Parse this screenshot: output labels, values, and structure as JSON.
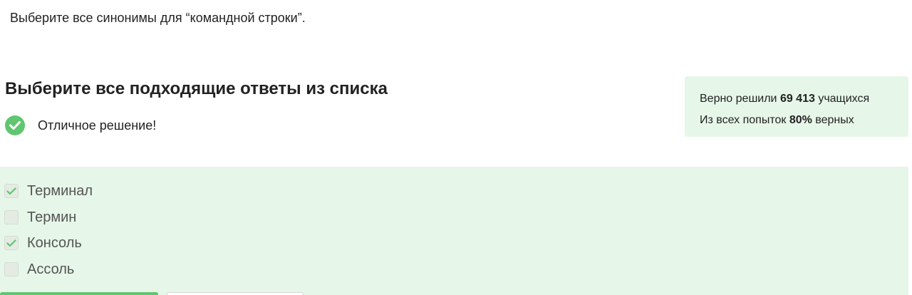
{
  "question": {
    "text": "Выберите все синонимы для “командной строки”."
  },
  "answer_section": {
    "title": "Выберите все подходящие ответы из списка",
    "status_text": "Отличное решение!",
    "status_icon": "check-circle-icon"
  },
  "stats": {
    "solved_prefix": "Верно решили ",
    "solved_count": "69 413",
    "solved_suffix": " учащихся",
    "attempts_prefix": "Из всех попыток ",
    "attempts_percent": "80%",
    "attempts_suffix": " верных"
  },
  "options": [
    {
      "label": "Терминал",
      "checked": true
    },
    {
      "label": "Термин",
      "checked": false
    },
    {
      "label": "Консоль",
      "checked": true
    },
    {
      "label": "Ассоль",
      "checked": false
    }
  ],
  "colors": {
    "accent": "#60c66f",
    "panel": "#e6f6e8"
  }
}
